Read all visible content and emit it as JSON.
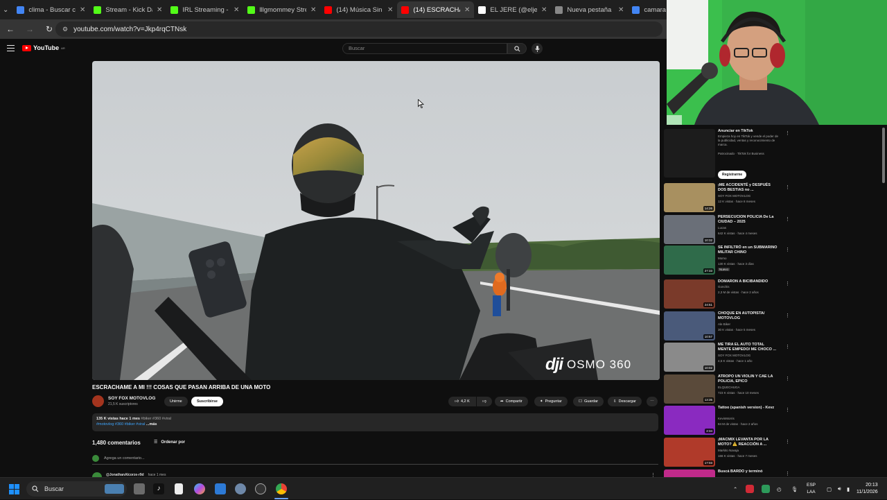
{
  "browser": {
    "tabs": [
      {
        "label": "clima - Buscar con",
        "color": "#4285f4"
      },
      {
        "label": "Stream - Kick Das",
        "color": "#53fc18"
      },
      {
        "label": "IRL Streaming - Li",
        "color": "#53fc18"
      },
      {
        "label": "lllgmommey Stre",
        "color": "#53fc18"
      },
      {
        "label": "(14) Música Sin C",
        "color": "#ff0000"
      },
      {
        "label": "(14) ESCRACHAM",
        "color": "#ff0000",
        "active": true
      },
      {
        "label": "EL JERE (@eljere",
        "color": "#ffffff"
      },
      {
        "label": "Nueva pestaña",
        "color": "#888888"
      },
      {
        "label": "camara",
        "color": "#4285f4"
      }
    ],
    "url": "youtube.com/watch?v=Jkp4rqCTNsk"
  },
  "youtube": {
    "logo": "YouTube",
    "logo_region": "AR",
    "search_placeholder": "Buscar",
    "video": {
      "watermark": "OSMO 360",
      "watermark_brand": "dji",
      "title": "ESCRACHAME A MI !!! COSAS QUE PASAN ARRIBA DE UNA MOTO",
      "channel": "SOY FOX MOTOVLOG",
      "subscribers": "21,5 K suscriptores",
      "join_label": "Unirme",
      "subscribe_label": "Suscribirse",
      "likes": "4,2 K",
      "share_label": "Compartir",
      "ask_label": "Preguntar",
      "save_label": "Guardar",
      "download_label": "Descargar",
      "desc_line1_meta": "135 K vistas  hace 1 mes",
      "desc_line1_tags": "#biker #360 #viral",
      "desc_line2_tags": "#motovlog #360 #biker #viral",
      "desc_more": "...más"
    },
    "comments": {
      "count_label": "1,480 comentarios",
      "sort_label": "Ordenar por",
      "add_placeholder": "Agrega un comentario...",
      "first_author": "@JonathanAlcorze-r9d",
      "first_time": "hace 1 mes"
    },
    "related": [
      {
        "title": "Anunciar en TikTok",
        "channel": "Empieza hoy en TikTok y vende el poder de la publicidad, ventas y reconocimiento de marca.",
        "meta": "Patrocinado · TikTok for Business",
        "cta": "Registrarme",
        "thumb": "#1c1c1c",
        "ad": true
      },
      {
        "title": "¡ME ACCIDENTÉ y DESPUÉS DOS BESTIAS no ...",
        "channel": "SOY FOX MOTOVLOG",
        "meta": "12 K vistas · hace 8 meses",
        "duration": "14:26",
        "thumb": "#a89060"
      },
      {
        "title": "PERSECUCION POLICIA De La CIUDAD – 2025",
        "channel": "Lucas",
        "meta": "642 K vistas · hace 4 meses",
        "duration": "10:32",
        "thumb": "#6a6f78"
      },
      {
        "title": "SE INFILTRÓ en un SUBMARINO MILITAR CHINO",
        "channel": "Momo",
        "meta": "130 K vistas · hace 3 días",
        "duration": "27:33",
        "badge": "Nuevo",
        "thumb": "#2f6b4a"
      },
      {
        "title": "DOMARON A BICIBANDIDO",
        "channel": "Gonchis",
        "meta": "2,3 M de vistas · hace 2 años",
        "duration": "24:51",
        "thumb": "#7a3a2a"
      },
      {
        "title": "CHOQUE EN AUTOPISTA/ MOTOVLOG",
        "channel": "Ale Biker",
        "meta": "30 K vistas · hace 5 meses",
        "duration": "10:57",
        "thumb": "#4a5a7a"
      },
      {
        "title": "ME TIRA EL AUTO TOTAL MENTE EMPEDO/ ME CHOCO ...",
        "channel": "SOY FOX MOTOVLOG",
        "meta": "4,5 K vistas · hace 1 año",
        "duration": "10:02",
        "thumb": "#8a8a8a"
      },
      {
        "title": "ATROPO UN VIOLIN Y CAE LA POLICIA, EPICO",
        "channel": "ELQUECHUGA",
        "meta": "723 K vistas · hace 10 meses",
        "duration": "13:35",
        "thumb": "#5a4a3a"
      },
      {
        "title": "Tattoo (spanish version) - Kevz",
        "channel": "KevinMorris",
        "meta": "84 M de vistas · hace 2 años",
        "duration": "2:34",
        "thumb": "#8a2ac0"
      },
      {
        "title": "¡MACMIX LEVANTA POR LA MOTO? ⚠️ REACCIÓN A ...",
        "channel": "Markito Navaja",
        "meta": "166 K vistas · hace 7 meses",
        "duration": "17:03",
        "thumb": "#b03a2a"
      },
      {
        "title": "Buscá BARDO y terminó",
        "channel": "",
        "meta": "",
        "duration": "",
        "thumb": "#c02a8a"
      }
    ]
  },
  "taskbar": {
    "search_label": "Buscar",
    "lang_top": "ESP",
    "lang_bottom": "LAA",
    "time": "20:13",
    "date": "11/1/2026"
  }
}
